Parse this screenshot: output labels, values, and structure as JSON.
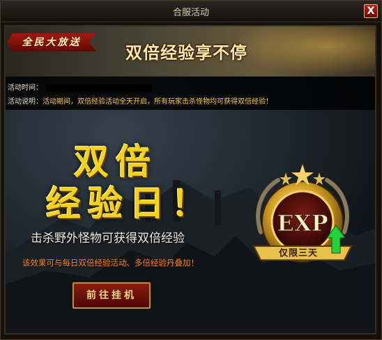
{
  "window": {
    "title": "合服活动",
    "close_label": "X"
  },
  "banner": {
    "tag": "全民大放送",
    "headline": "双倍经验享不停"
  },
  "info": {
    "time_label": "活动时间：",
    "desc_label": "活动说明：",
    "desc_text": "活动期间，双倍经验活动全天开启，所有玩家击杀怪物均可获得双倍经验！"
  },
  "content": {
    "big_title_line1": "双倍",
    "big_title_line2": "经验日！",
    "subtitle": "击杀野外怪物可获得双倍经验",
    "note": "该效果可与每日双倍经验活动、多倍经验丹叠加！",
    "go_button": "前往挂机"
  },
  "medal": {
    "text": "EXP",
    "ribbon": "仅限三天"
  },
  "colors": {
    "accent_gold": "#f4d21c",
    "desc_yellow": "#ffcc33",
    "note_orange": "#ff8a1c",
    "button_red": "#8d1c10"
  }
}
